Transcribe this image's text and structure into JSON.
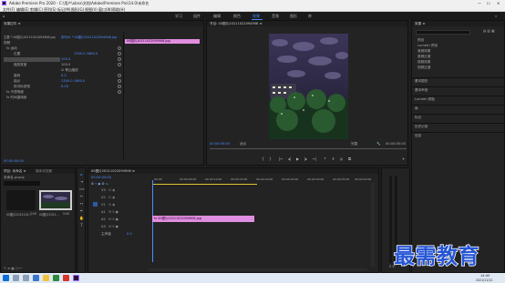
{
  "window": {
    "title": "Adobe Premiere Pro 2020 - C:\\用户\\xbnx\\文档\\Adobe\\Premiere Pro\\14.0\\未命名",
    "min": "—",
    "max": "☐",
    "close": "✕"
  },
  "menu": [
    "文件(F)",
    "编辑(E)",
    "剪辑(C)",
    "序列(S)",
    "标记(M)",
    "图形(G)",
    "视图(V)",
    "窗口(W)",
    "帮助(H)"
  ],
  "workspaces": {
    "items": [
      "学习",
      "组件",
      "编辑",
      "颜色",
      "效果",
      "音频",
      "图形",
      "库"
    ],
    "active": 4
  },
  "effect_controls": {
    "tab_label": "效果控件 ≡",
    "source": "主要 * 00图片20211022094906.jpg",
    "clip": "序列01 * 00图片20211022094906.jpg",
    "video_label": "视频",
    "rows": [
      {
        "label": "fx 运动",
        "value": ""
      },
      {
        "label": "位置",
        "value": "1300.0   1680.0"
      },
      {
        "label": "缩放",
        "value": "100.0"
      },
      {
        "label": "缩放宽度",
        "value": "100.0"
      },
      {
        "label": "",
        "value": "☑ 等比缩放"
      },
      {
        "label": "旋转",
        "value": "0.0"
      },
      {
        "label": "锚点",
        "value": "1300.0   1680.0"
      },
      {
        "label": "防闪烁滤镜",
        "value": "0.00"
      },
      {
        "label": "fx 不透明度",
        "value": ""
      },
      {
        "label": "fx 时间重映射",
        "value": ""
      }
    ],
    "time": "00:00:00:00",
    "clip_bar_label": "00图片20211022094906.jpg"
  },
  "program": {
    "tab_label": "节目: 00图片20211022094906 ≡",
    "timecode": "00:00:00:00",
    "fit": "适合",
    "quality": "完整",
    "duration": "00:00:05:00"
  },
  "right_panel": {
    "title": "效果 ≡",
    "search_placeholder": "",
    "folders": [
      "预设",
      "Lumetri 预设",
      "音频效果",
      "音频过渡",
      "视频效果",
      "视频过渡"
    ],
    "sections": [
      "基本图形",
      "基本声音",
      "Lumetri 颜色",
      "库",
      "标记",
      "历史记录",
      "信息"
    ]
  },
  "project": {
    "tab_label": "项目: 未命名 ≡",
    "tab2": "媒体浏览器",
    "name": "未命名.prproj",
    "items": [
      {
        "name": "00图片2021102...",
        "duration": "5:00"
      },
      {
        "name": "00图片2021...",
        "duration": "5:00"
      }
    ]
  },
  "timeline": {
    "tab_label": "00图片20211022094906 ≡",
    "timecode": "00:00:00:00",
    "ruler": [
      "00:00",
      "00:00:05:00",
      "00:00:10:00",
      "00:00:15:00",
      "00:00:20:00",
      "00:00:25:00",
      "00:00:30:00",
      "00:00:35:00",
      "00:00:40:00"
    ],
    "tracks": [
      "V3",
      "V2",
      "V1",
      "A1",
      "A2",
      "A3"
    ],
    "master_label": "主声道",
    "master_value": "0.0",
    "clip_label": "fx 00图片20211022094906.jpg"
  },
  "taskbar": {
    "time": "14:40",
    "date": "2021/11/12"
  },
  "watermark": "最需教育"
}
